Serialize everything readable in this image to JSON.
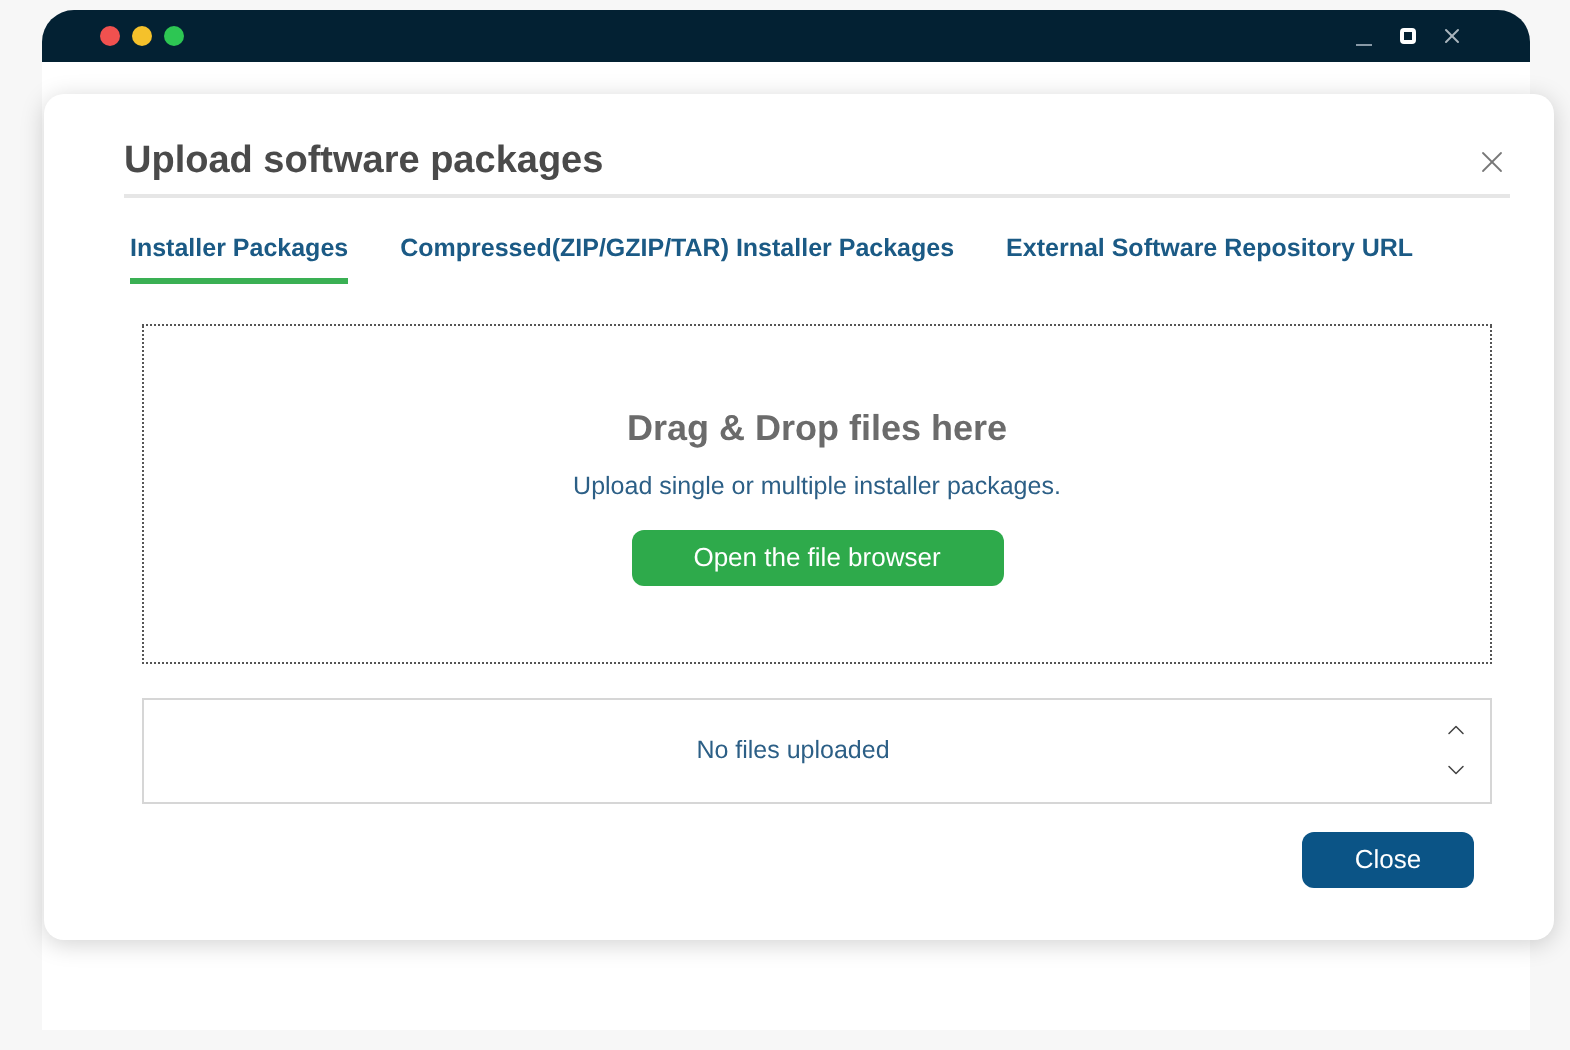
{
  "dialog": {
    "title": "Upload software packages"
  },
  "tabs": [
    {
      "label": "Installer Packages",
      "selected": true
    },
    {
      "label": "Compressed(ZIP/GZIP/TAR) Installer Packages",
      "selected": false
    },
    {
      "label": "External Software Repository URL",
      "selected": false
    }
  ],
  "dropzone": {
    "heading": "Drag & Drop files here",
    "hint": "Upload single or multiple installer packages.",
    "button": "Open the file browser"
  },
  "file_list": {
    "empty_text": "No files uploaded"
  },
  "buttons": [
    "Close"
  ]
}
